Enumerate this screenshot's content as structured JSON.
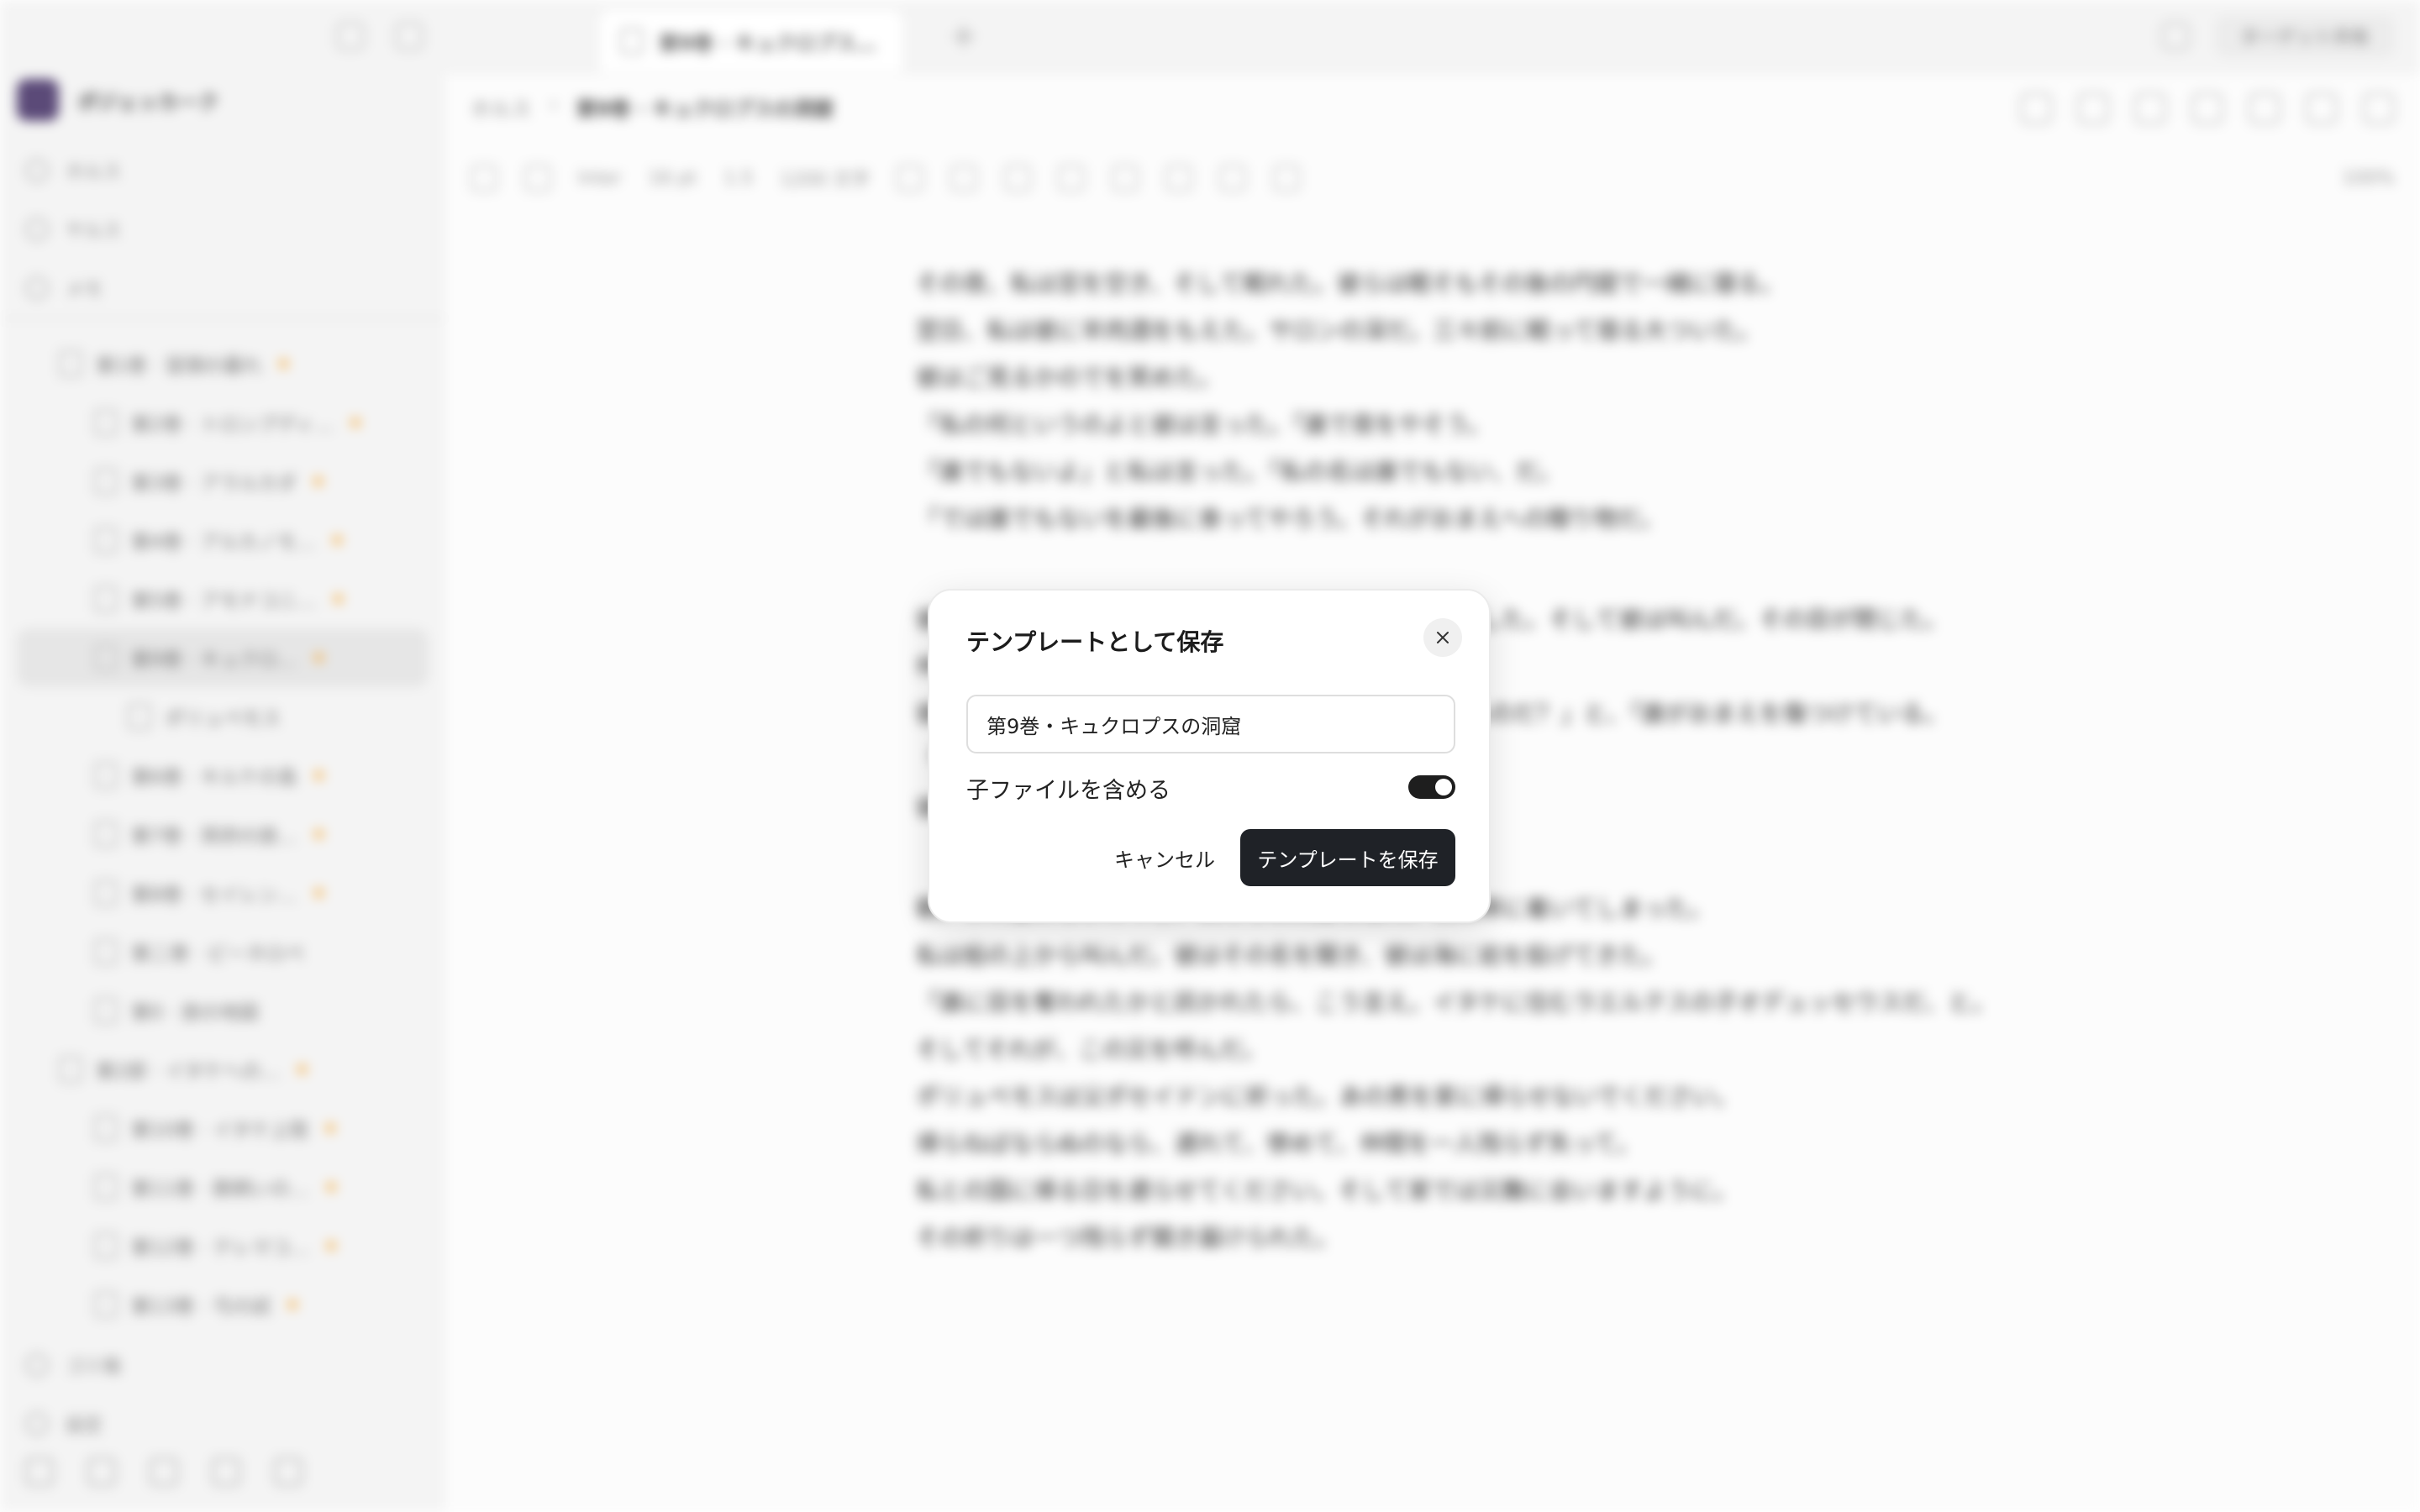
{
  "sidebar": {
    "workspace_name": "ポジェッカーク",
    "nav": [
      {
        "label": "ホルス"
      },
      {
        "label": "ヤルス"
      },
      {
        "label": "メモ"
      }
    ],
    "tree": [
      {
        "label": "第1巻 · 冒頭の暮れ",
        "level": 1,
        "starred": true,
        "active": false
      },
      {
        "label": "第2巻 · トロンプディ…",
        "level": 2,
        "starred": true,
        "active": false
      },
      {
        "label": "第3巻 · アラルカダ",
        "level": 2,
        "starred": true,
        "active": false
      },
      {
        "label": "第4巻 · アルカノモ…",
        "level": 2,
        "starred": true,
        "active": false
      },
      {
        "label": "第5巻 · アモナコニ…",
        "level": 2,
        "starred": true,
        "active": false
      },
      {
        "label": "第9巻 · キュクロ…",
        "level": 2,
        "starred": true,
        "active": true
      },
      {
        "label": "ポリュペモス",
        "level": 3,
        "starred": false,
        "active": false
      },
      {
        "label": "第6巻 · キルケの島",
        "level": 2,
        "starred": true,
        "active": false
      },
      {
        "label": "第7巻 · 冥府の旅…",
        "level": 2,
        "starred": true,
        "active": false
      },
      {
        "label": "第8巻 · セイレン…",
        "level": 2,
        "starred": true,
        "active": false
      },
      {
        "label": "第二巻 · ピーネロペ",
        "level": 2,
        "starred": false,
        "active": false
      },
      {
        "label": "第0 · 旅の地図",
        "level": 2,
        "starred": false,
        "active": false
      },
      {
        "label": "第2部 · イタケへの…",
        "level": 1,
        "starred": true,
        "active": false
      },
      {
        "label": "第10巻 · イタケ上陸",
        "level": 2,
        "starred": true,
        "active": false
      },
      {
        "label": "第11巻 · 豚飼いの…",
        "level": 2,
        "starred": true,
        "active": false
      },
      {
        "label": "第12巻 · テレマコ…",
        "level": 2,
        "starred": true,
        "active": false
      },
      {
        "label": "第13巻 · 弓の試",
        "level": 2,
        "starred": true,
        "active": false
      }
    ],
    "bottom": [
      {
        "label": "ゴミ箱"
      },
      {
        "label": "設定"
      }
    ]
  },
  "tabbar": {
    "tab_title": "第9巻 · キュクロプス…",
    "share_label": "ターゲット共有"
  },
  "breadcrumb": {
    "root": "ホルス",
    "current": "第9巻 · キュクロプスの洞窟"
  },
  "format_bar": {
    "style": "Inter",
    "font_size": "16 pt",
    "line_spacing": "1.5",
    "width": "1200 文字",
    "zoom": "100%"
  },
  "document": {
    "lines": [
      "その夜、私は窓を空き、そして眠れた。彼らは眠そもその後の円窟で一緒に寝る。",
      "翌日、私は彼に羊肉酒をもえた。サロンの深だ。三々前に眠って宿る大ついた。",
      "彼はご見るかのでを笑めた。",
      "「私の何というのよと彼は言った。「誰で夜をやそう。",
      "「誰でもないよ」と私は言った。「私の名は誰でもない、だ。",
      "「では誰でもないを最後に食ってやろう。それがおまえへの贈り物だ。",
      "",
      "彼は眠り込んだ。私たちは杭を焼き、その目に突き刺した。そして彼は叫んだ。その目が閉じた。",
      "仲間たちは逃げた。",
      "彼の仲間が集まってきた。「誰がおまえを傷つけているのだ？」と、「誰がおまえを傷つけている。",
      "「誰でもない！」",
      "彼らは帰ってしまった。",
      "",
      "朝、羊の腹にしがみつき、私たちは洞窟を出た。私は岸に着いてしまった。",
      "私は船の上から叫んだ。彼はその名を聞き、彼は海に岩を投げてきた。",
      "「誰に目を奪われたかと訊かれたら、こう言え。イタケに住むラエルテスの子オデュッセウスだ、と。",
      "そしてそれが、この災を呼んだ。",
      "ポリュペモスは父ポセイドンに祈った。あの男を家に帰らせないでください。",
      "帰らねばならぬのなら、遅れて、惨めて、仲間を一人残らず失って。",
      "私との国に帰る日を遅らせてください。そして家では災難に会いますように。",
      "その祈りは一つ残らず聞き届けられた。"
    ]
  },
  "modal": {
    "title": "テンプレートとして保存",
    "name_value": "第9巻・キュクロプスの洞窟",
    "toggle_label": "子ファイルを含める",
    "toggle_on": true,
    "cancel_label": "キャンセル",
    "save_label": "テンプレートを保存"
  }
}
